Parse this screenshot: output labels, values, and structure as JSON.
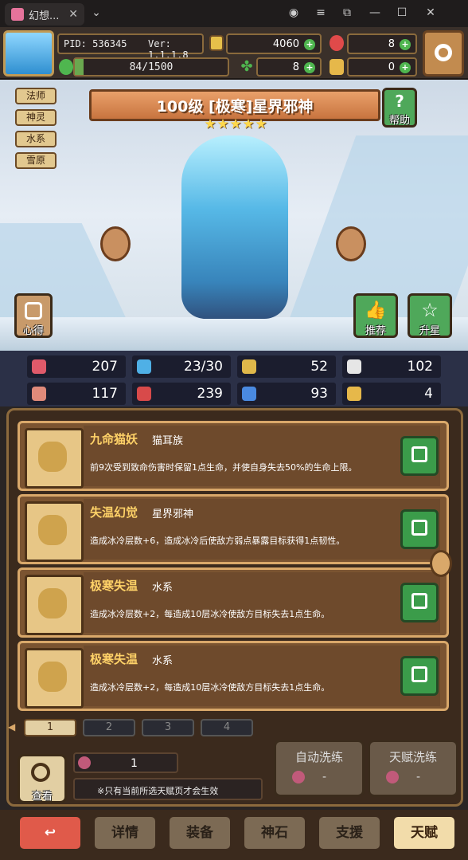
{
  "window": {
    "tab_title": "幻想...",
    "close_glyph": "✕",
    "dropdown_glyph": "⌄"
  },
  "hud": {
    "pid": "PID: 536345",
    "version": "Ver: 1.1.1.8",
    "exp": "84/1500",
    "exp_progress": 0.056,
    "gold": "4060",
    "gems": "8",
    "clover": "8",
    "scroll": "0"
  },
  "hero": {
    "tags": [
      "法师",
      "神灵",
      "水系",
      "雪原"
    ],
    "name": "100级 [极寒]星界邪神",
    "stars": 5,
    "help_label": "帮助",
    "insight_label": "心得",
    "recommend_label": "推荐",
    "upgrade_label": "升星"
  },
  "stats": [
    {
      "icon": "heart-icon",
      "value": "207",
      "color": "#e05a6a"
    },
    {
      "icon": "mana-drop-icon",
      "value": "23/30",
      "color": "#4fb0e6"
    },
    {
      "icon": "shield-icon",
      "value": "52",
      "color": "#e0b84a"
    },
    {
      "icon": "wing-icon",
      "value": "102",
      "color": "#e6e6e6"
    },
    {
      "icon": "fist-icon",
      "value": "117",
      "color": "#e08a7a"
    },
    {
      "icon": "book-icon",
      "value": "239",
      "color": "#d84a4a"
    },
    {
      "icon": "speed-icon",
      "value": "93",
      "color": "#4a8ae0"
    },
    {
      "icon": "horseshoe-icon",
      "value": "4",
      "color": "#e6b84a"
    }
  ],
  "talents": [
    {
      "title": "九命猫妖",
      "sub": "猫耳族",
      "desc": "前9次受到致命伤害时保留1点生命，并使自身失去50%的生命上限。"
    },
    {
      "title": "失温幻觉",
      "sub": "星界邪神",
      "desc": "造成冰冷层数+6，造成冰冷后使敌方弱点暴露目标获得1点韧性。"
    },
    {
      "title": "极寒失温",
      "sub": "水系",
      "desc": "造成冰冷层数+2，每造成10层冰冷使敌方目标失去1点生命。"
    },
    {
      "title": "极寒失温",
      "sub": "水系",
      "desc": "造成冰冷层数+2，每造成10层冰冷使敌方目标失去1点生命。"
    }
  ],
  "pages": [
    "1",
    "2",
    "3",
    "4"
  ],
  "controls": {
    "view_label": "查看",
    "fruit_count": "1",
    "note": "※只有当前所选天赋页才会生效",
    "auto_wash_label": "自动洗练",
    "auto_wash_value": "-",
    "talent_wash_label": "天赋洗练",
    "talent_wash_value": "-"
  },
  "nav": [
    "详情",
    "装备",
    "神石",
    "支援",
    "天赋"
  ],
  "nav_active": "天赋",
  "back_glyph": "↩"
}
